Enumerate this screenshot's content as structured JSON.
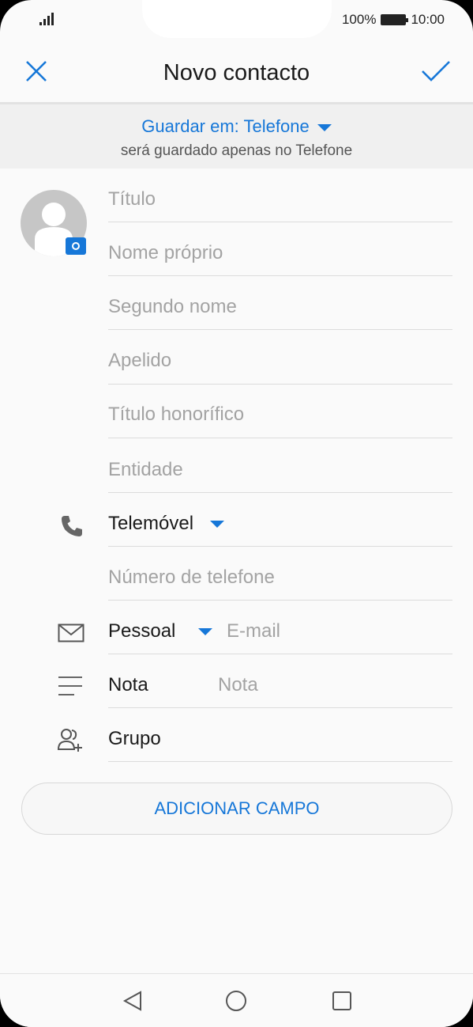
{
  "status_bar": {
    "battery": "100%",
    "time": "10:00"
  },
  "header": {
    "title": "Novo contacto"
  },
  "save_location": {
    "label": "Guardar em: Telefone",
    "subtitle": "será guardado apenas no Telefone"
  },
  "fields": {
    "titulo": "Título",
    "nome_proprio": "Nome próprio",
    "segundo_nome": "Segundo nome",
    "apelido": "Apelido",
    "titulo_honorifico": "Título honorífico",
    "entidade": "Entidade"
  },
  "phone": {
    "type": "Telemóvel",
    "placeholder": "Número de telefone"
  },
  "email": {
    "type": "Pessoal",
    "placeholder": "E-mail"
  },
  "note": {
    "label": "Nota",
    "placeholder": "Nota"
  },
  "group": {
    "label": "Grupo"
  },
  "add_field_button": "ADICIONAR CAMPO",
  "colors": {
    "accent": "#1677d8",
    "background": "#fafafa",
    "band": "#f0f0f0"
  }
}
